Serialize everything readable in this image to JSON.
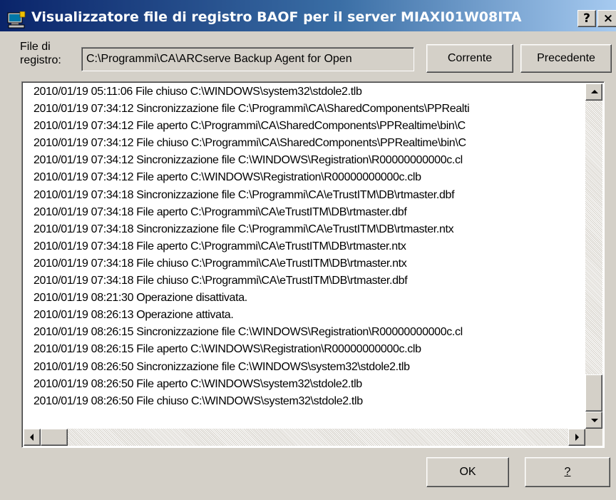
{
  "window": {
    "title": "Visualizzatore file di registro BAOF per il server MIAXI01W08ITA",
    "help_glyph": "?",
    "close_glyph": "×"
  },
  "file_row": {
    "label": "File di registro:",
    "path": "C:\\Programmi\\CA\\ARCserve Backup Agent for Open",
    "current_button": "Corrente",
    "previous_button": "Precedente"
  },
  "log": {
    "lines": [
      "2010/01/19 05:11:06 File chiuso C:\\WINDOWS\\system32\\stdole2.tlb",
      "2010/01/19 07:34:12 Sincronizzazione file C:\\Programmi\\CA\\SharedComponents\\PPRealti",
      "2010/01/19 07:34:12 File aperto C:\\Programmi\\CA\\SharedComponents\\PPRealtime\\bin\\C",
      "2010/01/19 07:34:12 File chiuso C:\\Programmi\\CA\\SharedComponents\\PPRealtime\\bin\\C",
      "2010/01/19 07:34:12 Sincronizzazione file C:\\WINDOWS\\Registration\\R00000000000c.cl",
      "2010/01/19 07:34:12 File aperto C:\\WINDOWS\\Registration\\R00000000000c.clb",
      "2010/01/19 07:34:18 Sincronizzazione file C:\\Programmi\\CA\\eTrustITM\\DB\\rtmaster.dbf",
      "2010/01/19 07:34:18 File aperto C:\\Programmi\\CA\\eTrustITM\\DB\\rtmaster.dbf",
      "2010/01/19 07:34:18 Sincronizzazione file C:\\Programmi\\CA\\eTrustITM\\DB\\rtmaster.ntx",
      "2010/01/19 07:34:18 File aperto C:\\Programmi\\CA\\eTrustITM\\DB\\rtmaster.ntx",
      "2010/01/19 07:34:18 File chiuso C:\\Programmi\\CA\\eTrustITM\\DB\\rtmaster.ntx",
      "2010/01/19 07:34:18 File chiuso C:\\Programmi\\CA\\eTrustITM\\DB\\rtmaster.dbf",
      "2010/01/19 08:21:30 Operazione disattivata.",
      "2010/01/19 08:26:13 Operazione attivata.",
      "2010/01/19 08:26:15 Sincronizzazione file C:\\WINDOWS\\Registration\\R00000000000c.cl",
      "2010/01/19 08:26:15 File aperto C:\\WINDOWS\\Registration\\R00000000000c.clb",
      "2010/01/19 08:26:50 Sincronizzazione file C:\\WINDOWS\\system32\\stdole2.tlb",
      "2010/01/19 08:26:50 File aperto C:\\WINDOWS\\system32\\stdole2.tlb",
      "2010/01/19 08:26:50 File chiuso C:\\WINDOWS\\system32\\stdole2.tlb"
    ]
  },
  "footer": {
    "ok_button": "OK",
    "help_button": "?"
  },
  "colors": {
    "titlebar_start": "#0a246a",
    "titlebar_end": "#a6caf0",
    "dialog_face": "#d4d0c8"
  }
}
